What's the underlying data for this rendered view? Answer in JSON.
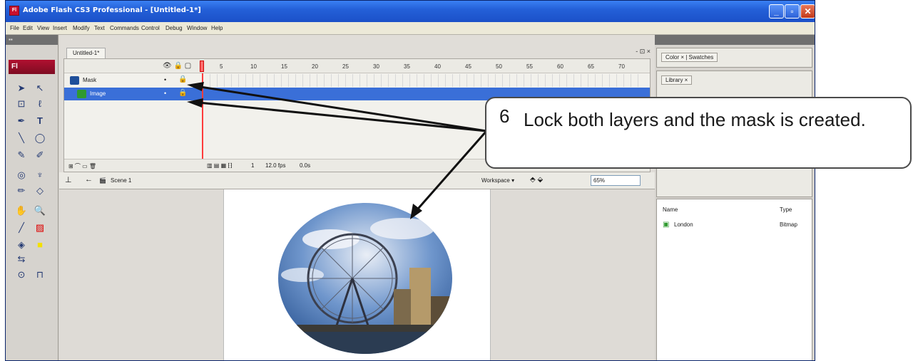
{
  "window": {
    "title": "Adobe Flash CS3 Professional - [Untitled-1*]",
    "app_icon": "Fl",
    "buttons": [
      "_",
      "▫",
      "✕"
    ]
  },
  "menu": [
    "File",
    "Edit",
    "View",
    "Insert",
    "Modify",
    "Text",
    "Commands",
    "Control",
    "Debug",
    "Window",
    "Help"
  ],
  "tools": {
    "header": "▪▪",
    "logo": "Fl"
  },
  "document": {
    "tab": "Untitled-1*",
    "controls": "- ⊡ ×",
    "frame_numbers": [
      "5",
      "10",
      "15",
      "20",
      "25",
      "30",
      "35",
      "40",
      "45",
      "50",
      "55",
      "60",
      "65",
      "70"
    ],
    "layers": [
      {
        "name": "Mask",
        "visible": "•",
        "locked": "🔒",
        "icon_color": "#1f4f9a"
      },
      {
        "name": "Image",
        "visible": "•",
        "locked": "🔒",
        "icon_color": "#2f9a2f",
        "selected": true
      }
    ],
    "timeline_footer": {
      "frame": "1",
      "fps": "12.0 fps",
      "time": "0.0s"
    },
    "scene": "Scene 1",
    "workspace": "Workspace ▾",
    "zoom": "65%"
  },
  "panels": {
    "color_tab": "Color × | Swatches",
    "library_tab": "Library ×",
    "library_columns": {
      "name": "Name",
      "type": "Type"
    },
    "library_items": [
      {
        "name": "London",
        "type": "Bitmap"
      }
    ]
  },
  "callout": {
    "step": "6",
    "text": "Lock both layers and the mask is created."
  },
  "colors": {
    "titlebar": "#2460d8",
    "selected_layer": "#3a6fd8",
    "playhead": "#ff3c3c"
  }
}
